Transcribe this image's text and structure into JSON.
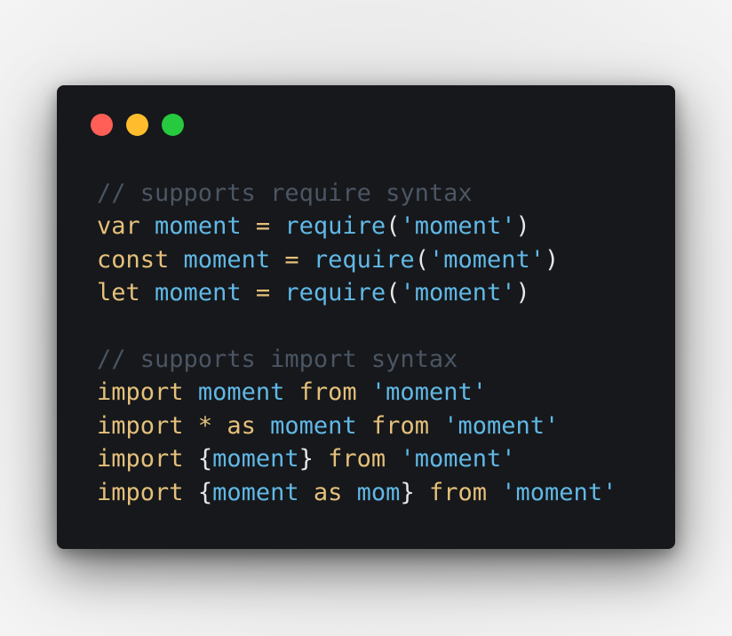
{
  "colors": {
    "red_dot": "#ff5f56",
    "yellow_dot": "#ffbd2e",
    "green_dot": "#27c93f",
    "comment": "#4b5563",
    "keyword": "#e5c07b",
    "identifier": "#61b8e6",
    "string": "#61b8e6",
    "punct": "#e6e6e6",
    "operator": "#e5c07b"
  },
  "code": {
    "lines": [
      [
        {
          "text": "// supports require syntax",
          "kind": "comment"
        }
      ],
      [
        {
          "text": "var",
          "kind": "keyword"
        },
        {
          "text": " ",
          "kind": "punct"
        },
        {
          "text": "moment",
          "kind": "identifier"
        },
        {
          "text": " ",
          "kind": "punct"
        },
        {
          "text": "=",
          "kind": "operator"
        },
        {
          "text": " ",
          "kind": "punct"
        },
        {
          "text": "require",
          "kind": "identifier"
        },
        {
          "text": "(",
          "kind": "punct"
        },
        {
          "text": "'moment'",
          "kind": "string"
        },
        {
          "text": ")",
          "kind": "punct"
        }
      ],
      [
        {
          "text": "const",
          "kind": "keyword"
        },
        {
          "text": " ",
          "kind": "punct"
        },
        {
          "text": "moment",
          "kind": "identifier"
        },
        {
          "text": " ",
          "kind": "punct"
        },
        {
          "text": "=",
          "kind": "operator"
        },
        {
          "text": " ",
          "kind": "punct"
        },
        {
          "text": "require",
          "kind": "identifier"
        },
        {
          "text": "(",
          "kind": "punct"
        },
        {
          "text": "'moment'",
          "kind": "string"
        },
        {
          "text": ")",
          "kind": "punct"
        }
      ],
      [
        {
          "text": "let",
          "kind": "keyword"
        },
        {
          "text": " ",
          "kind": "punct"
        },
        {
          "text": "moment",
          "kind": "identifier"
        },
        {
          "text": " ",
          "kind": "punct"
        },
        {
          "text": "=",
          "kind": "operator"
        },
        {
          "text": " ",
          "kind": "punct"
        },
        {
          "text": "require",
          "kind": "identifier"
        },
        {
          "text": "(",
          "kind": "punct"
        },
        {
          "text": "'moment'",
          "kind": "string"
        },
        {
          "text": ")",
          "kind": "punct"
        }
      ],
      [],
      [
        {
          "text": "// supports import syntax",
          "kind": "comment"
        }
      ],
      [
        {
          "text": "import",
          "kind": "keyword"
        },
        {
          "text": " ",
          "kind": "punct"
        },
        {
          "text": "moment",
          "kind": "identifier"
        },
        {
          "text": " ",
          "kind": "punct"
        },
        {
          "text": "from",
          "kind": "keyword"
        },
        {
          "text": " ",
          "kind": "punct"
        },
        {
          "text": "'moment'",
          "kind": "string"
        }
      ],
      [
        {
          "text": "import",
          "kind": "keyword"
        },
        {
          "text": " ",
          "kind": "punct"
        },
        {
          "text": "*",
          "kind": "operator"
        },
        {
          "text": " ",
          "kind": "punct"
        },
        {
          "text": "as",
          "kind": "keyword"
        },
        {
          "text": " ",
          "kind": "punct"
        },
        {
          "text": "moment",
          "kind": "identifier"
        },
        {
          "text": " ",
          "kind": "punct"
        },
        {
          "text": "from",
          "kind": "keyword"
        },
        {
          "text": " ",
          "kind": "punct"
        },
        {
          "text": "'moment'",
          "kind": "string"
        }
      ],
      [
        {
          "text": "import",
          "kind": "keyword"
        },
        {
          "text": " ",
          "kind": "punct"
        },
        {
          "text": "{",
          "kind": "punct"
        },
        {
          "text": "moment",
          "kind": "identifier"
        },
        {
          "text": "}",
          "kind": "punct"
        },
        {
          "text": " ",
          "kind": "punct"
        },
        {
          "text": "from",
          "kind": "keyword"
        },
        {
          "text": " ",
          "kind": "punct"
        },
        {
          "text": "'moment'",
          "kind": "string"
        }
      ],
      [
        {
          "text": "import",
          "kind": "keyword"
        },
        {
          "text": " ",
          "kind": "punct"
        },
        {
          "text": "{",
          "kind": "punct"
        },
        {
          "text": "moment",
          "kind": "identifier"
        },
        {
          "text": " ",
          "kind": "punct"
        },
        {
          "text": "as",
          "kind": "keyword"
        },
        {
          "text": " ",
          "kind": "punct"
        },
        {
          "text": "mom",
          "kind": "identifier"
        },
        {
          "text": "}",
          "kind": "punct"
        },
        {
          "text": " ",
          "kind": "punct"
        },
        {
          "text": "from",
          "kind": "keyword"
        },
        {
          "text": " ",
          "kind": "punct"
        },
        {
          "text": "'moment'",
          "kind": "string"
        }
      ]
    ]
  }
}
